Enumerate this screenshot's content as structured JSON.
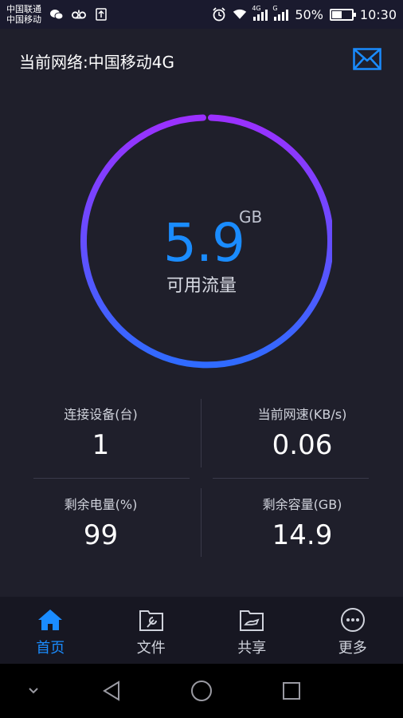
{
  "status_bar": {
    "carrier1": "中国联通",
    "carrier2": "中国移动",
    "network1": "4G",
    "network2": "G",
    "battery_text": "50%",
    "battery_level": 0.5,
    "time": "10:30"
  },
  "header": {
    "title": "当前网络:中国移动4G"
  },
  "usage": {
    "value": "5.9",
    "unit": "GB",
    "label": "可用流量"
  },
  "stats": [
    {
      "label": "连接设备(台)",
      "value": "1"
    },
    {
      "label": "当前网速(KB/s)",
      "value": "0.06"
    },
    {
      "label": "剩余电量(%)",
      "value": "99"
    },
    {
      "label": "剩余容量(GB)",
      "value": "14.9"
    }
  ],
  "nav": {
    "home": "首页",
    "files": "文件",
    "share": "共享",
    "more": "更多"
  },
  "colors": {
    "accent": "#1a8cff",
    "ring_start": "#9b30ff",
    "ring_end": "#2f6bff"
  }
}
